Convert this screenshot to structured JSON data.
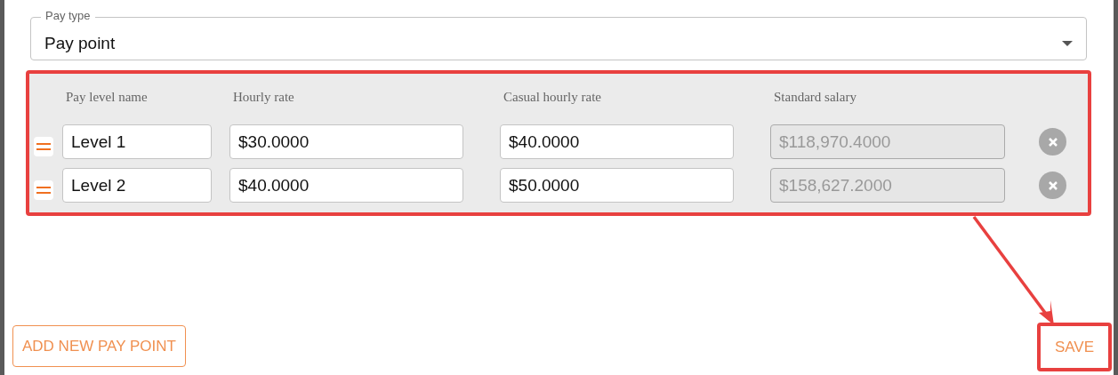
{
  "pay_type": {
    "label": "Pay type",
    "value": "Pay point"
  },
  "pay_levels": {
    "highlighted": true,
    "columns": [
      "Pay level name",
      "Hourly rate",
      "Casual hourly rate",
      "Standard salary"
    ],
    "rows": [
      {
        "name": "Level 1",
        "hourly_rate": "$30.0000",
        "casual_hourly_rate": "$40.0000",
        "standard_salary": "$118,970.4000",
        "salary_disabled": true
      },
      {
        "name": "Level 2",
        "hourly_rate": "$40.0000",
        "casual_hourly_rate": "$50.0000",
        "standard_salary": "$158,627.2000",
        "salary_disabled": true
      }
    ]
  },
  "buttons": [
    {
      "label": "ADD NEW PAY POINT",
      "highlighted": false
    },
    {
      "label": "SAVE",
      "highlighted": true
    }
  ]
}
